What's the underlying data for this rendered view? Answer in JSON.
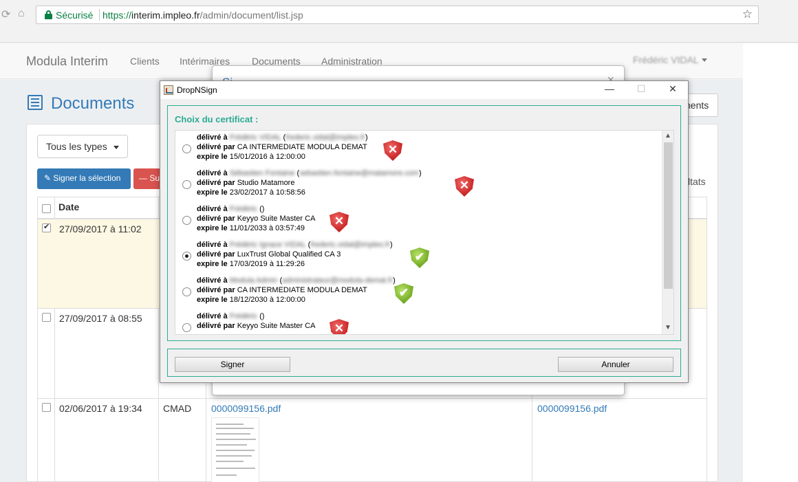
{
  "browser": {
    "nav_back": "⟳",
    "nav_home": "⌂",
    "secure_label": "Sécurisé",
    "url_scheme": "https://",
    "url_host": "interim.impleo.fr",
    "url_path": "/admin/document/list.jsp",
    "bookmark_glyph": "☆"
  },
  "app": {
    "brand": "Modula Interim",
    "nav": [
      "Clients",
      "Intérimaires",
      "Documents",
      "Administration"
    ],
    "user_name": "Frédéric VIDAL"
  },
  "page": {
    "title": "Documents",
    "right_button_partial": "nents",
    "type_filter": "Tous les types",
    "sign_selection": "Signer la sélection",
    "delete_partial": "Su",
    "results_partial": "ltats"
  },
  "table": {
    "col_date": "Date",
    "rows": [
      {
        "date": "27/09/2017 à 11:02",
        "checked": true,
        "type": ""
      },
      {
        "date": "27/09/2017 à 08:55",
        "checked": false,
        "type": ""
      },
      {
        "date": "02/06/2017 à 19:34",
        "checked": false,
        "type": "CMAD",
        "file1": "0000099156.pdf",
        "file2": "0000099156.pdf"
      }
    ]
  },
  "background_dialog": {
    "title_partial": "Si",
    "close": "×"
  },
  "window": {
    "title": "DropNSign",
    "ctrl_min": "—",
    "ctrl_max": "☐",
    "ctrl_close": "✕",
    "heading": "Choix du certificat :",
    "labels": {
      "issued_to": "délivré à",
      "issued_by": "délivré par",
      "expires": "expire le"
    },
    "certificates": [
      {
        "to_name": "Frédéric VIDAL",
        "to_email": "frederic.vidal@impleo.fr",
        "by": "CA INTERMEDIATE MODULA DEMAT",
        "expires": "15/01/2016 à 12:00:00",
        "valid": false,
        "selected": false
      },
      {
        "to_name": "Sébastien Fontaine",
        "to_email": "sebastien.fontaine@matamore.com",
        "by": "Studio Matamore",
        "expires": "23/02/2017 à 10:58:56",
        "valid": false,
        "selected": false
      },
      {
        "to_name": "Frédéric",
        "to_email": "",
        "by": "Keyyo Suite Master CA",
        "expires": "11/01/2033 à 03:57:49",
        "valid": false,
        "selected": false
      },
      {
        "to_name": "Frédéric Ignace VIDAL",
        "to_email": "frederic.vidal@impleo.fr",
        "by": "LuxTrust Global Qualified CA 3",
        "expires": "17/03/2019 à 11:29:26",
        "valid": true,
        "selected": true
      },
      {
        "to_name": "Modula Admin",
        "to_email": "administrateur@modula-demat.fr",
        "by": "CA INTERMEDIATE MODULA DEMAT",
        "expires": "18/12/2030 à 12:00:00",
        "valid": true,
        "selected": false
      },
      {
        "to_name": "Frédéric",
        "to_email": "",
        "by": "Keyyo Suite Master CA",
        "expires": "",
        "valid": false,
        "selected": false
      }
    ],
    "sign_button": "Signer",
    "cancel_button": "Annuler"
  }
}
